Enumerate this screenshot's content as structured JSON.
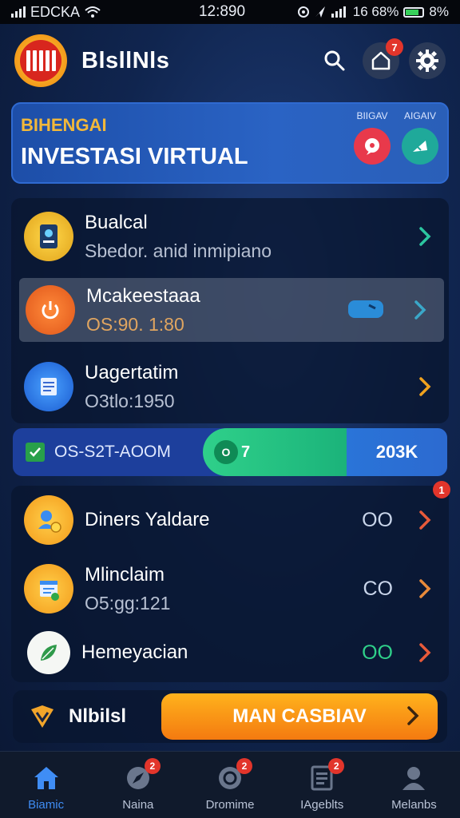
{
  "status_bar": {
    "carrier": "EDCKA",
    "time": "12:890",
    "battery_text": "16 68%",
    "battery_percent_text": "8%"
  },
  "header": {
    "app_title": "BlsllNls",
    "home_badge": "7"
  },
  "banner": {
    "kicker": "BIHENGAI",
    "title": "INVESTASI VIRTUAL",
    "action_1_label": "BIIGAV",
    "action_2_label": "AIGAIV"
  },
  "list_top": [
    {
      "title": "Bualcal",
      "subtitle": "Sbedor. anid inmipiano",
      "chevron_color": "#2cc6a0"
    },
    {
      "title": "Mcakeestaaa",
      "subtitle": "OS:90. 1:80",
      "chevron_color": "#3aa7c9"
    },
    {
      "title": "Uagertatim",
      "subtitle": "O3tlo:1950",
      "chevron_color": "#f0a21e"
    }
  ],
  "progress": {
    "label": "OS-S2T-AOOM",
    "pill": "O",
    "percent_text": "7",
    "right_text": "203K",
    "fill_fraction": 0.33
  },
  "list_bottom": {
    "badge": "1",
    "rows": [
      {
        "title": "Diners Yaldare",
        "subtitle": "",
        "value": "OO",
        "value_color": "#c9d5ea",
        "chevron_color": "#e85a3a"
      },
      {
        "title": "Mlinclaim",
        "subtitle": "O5:gg:121",
        "value": "CO",
        "value_color": "#c9d5ea",
        "chevron_color": "#e88a3a"
      },
      {
        "title": "Hemeyacian",
        "subtitle": "",
        "value": "OO",
        "value_color": "#2fd08a",
        "chevron_color": "#e85a3a"
      }
    ]
  },
  "footer": {
    "label": "Nlbilsl",
    "cta": "MAN CASBIAV"
  },
  "tabs": [
    {
      "label": "Biamic",
      "badge": ""
    },
    {
      "label": "Naina",
      "badge": "2"
    },
    {
      "label": "Dromime",
      "badge": "2"
    },
    {
      "label": "IAgeblts",
      "badge": "2"
    },
    {
      "label": "Melanbs",
      "badge": ""
    }
  ],
  "colors": {
    "accent_blue": "#3f8df5",
    "cta_orange": "#f47a10",
    "progress_green": "#2fd08a"
  }
}
